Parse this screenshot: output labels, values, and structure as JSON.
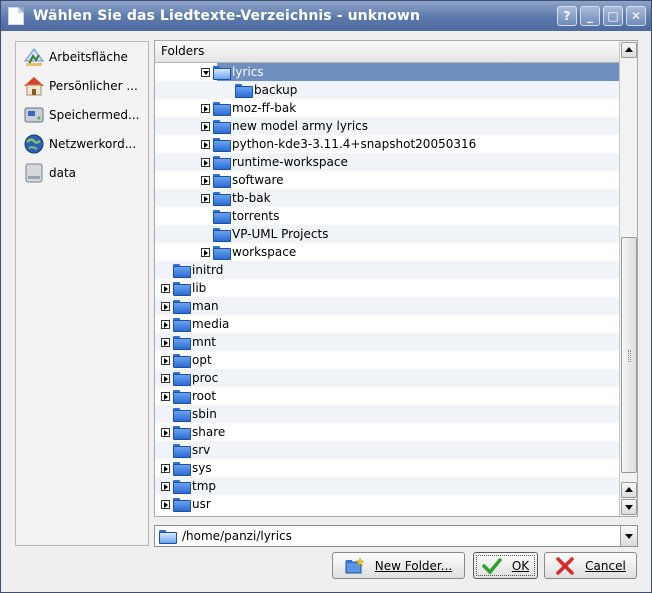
{
  "window": {
    "title": "Wählen Sie das Liedtexte-Verzeichnis - unknown",
    "buttons": {
      "help": "?",
      "minimize": "_",
      "maximize": "□",
      "close": "✕"
    }
  },
  "sidebar": {
    "items": [
      {
        "label": "Arbeitsfläche",
        "icon": "desktop-icon"
      },
      {
        "label": "Persönlicher ...",
        "icon": "home-folder-icon"
      },
      {
        "label": "Speichermed...",
        "icon": "storage-media-icon"
      },
      {
        "label": "Netzwerkord...",
        "icon": "network-folder-icon"
      },
      {
        "label": "data",
        "icon": "drive-icon"
      }
    ]
  },
  "tree": {
    "header": "Folders",
    "rows": [
      {
        "label": "lyrics",
        "expander": "open",
        "depth": 2,
        "selected": true,
        "icon": "folder-open-icon"
      },
      {
        "label": "backup",
        "expander": "none",
        "depth": 3,
        "selected": false
      },
      {
        "label": "moz-ff-bak",
        "expander": "closed",
        "depth": 2
      },
      {
        "label": "new model army lyrics",
        "expander": "closed",
        "depth": 2
      },
      {
        "label": "python-kde3-3.11.4+snapshot20050316",
        "expander": "closed",
        "depth": 2
      },
      {
        "label": "runtime-workspace",
        "expander": "closed",
        "depth": 2
      },
      {
        "label": "software",
        "expander": "closed",
        "depth": 2
      },
      {
        "label": "tb-bak",
        "expander": "closed",
        "depth": 2
      },
      {
        "label": "torrents",
        "expander": "none",
        "depth": 2
      },
      {
        "label": "VP-UML Projects",
        "expander": "none",
        "depth": 2
      },
      {
        "label": "workspace",
        "expander": "closed",
        "depth": 2
      },
      {
        "label": "initrd",
        "expander": "none",
        "depth": 0
      },
      {
        "label": "lib",
        "expander": "closed",
        "depth": 0
      },
      {
        "label": "man",
        "expander": "closed",
        "depth": 0
      },
      {
        "label": "media",
        "expander": "closed",
        "depth": 0
      },
      {
        "label": "mnt",
        "expander": "closed",
        "depth": 0
      },
      {
        "label": "opt",
        "expander": "closed",
        "depth": 0
      },
      {
        "label": "proc",
        "expander": "closed",
        "depth": 0
      },
      {
        "label": "root",
        "expander": "closed",
        "depth": 0
      },
      {
        "label": "sbin",
        "expander": "none",
        "depth": 0
      },
      {
        "label": "share",
        "expander": "closed",
        "depth": 0
      },
      {
        "label": "srv",
        "expander": "none",
        "depth": 0
      },
      {
        "label": "sys",
        "expander": "closed",
        "depth": 0
      },
      {
        "label": "tmp",
        "expander": "closed",
        "depth": 0,
        "icon": "folder-locked-icon"
      },
      {
        "label": "usr",
        "expander": "closed",
        "depth": 0
      }
    ]
  },
  "path_field": {
    "value": "/home/panzi/lyrics",
    "icon": "folder-icon"
  },
  "buttons": {
    "new_folder": {
      "label": "New Folder...",
      "icon": "new-folder-icon"
    },
    "ok": {
      "label": "OK",
      "icon": "checkmark-icon"
    },
    "cancel": {
      "label": "Cancel",
      "icon": "cancel-x-icon"
    }
  },
  "colors": {
    "titlebar": "#5c79ac",
    "selection": "#6e8fc0",
    "folder": "#2a6cd4"
  }
}
